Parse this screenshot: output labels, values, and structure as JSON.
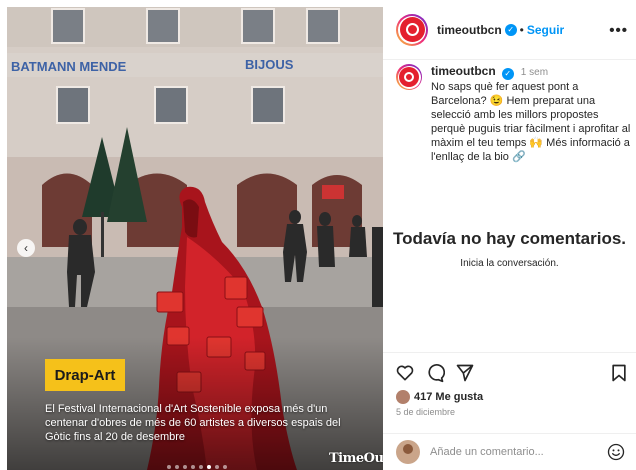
{
  "post_media": {
    "tag": "Drap-Art",
    "caption": "El Festival Internacional d'Art Sostenible exposa més d'un centenar d'obres de més de 60 artistes a diversos espais del Gòtic fins al 20 de desembre",
    "watermark": "TimeOut",
    "carousel_dots": 8,
    "active_dot": 6,
    "storefront_signs": [
      "BATMANN MENDE",
      "BIJOUS"
    ],
    "colors": {
      "tag_bg": "#f5c11a",
      "sculpture": "#c81e1e"
    }
  },
  "header": {
    "username": "timeoutbcn",
    "separator": "•",
    "follow_label": "Seguir",
    "more_label": "•••"
  },
  "post": {
    "username": "timeoutbcn",
    "time": "1 sem",
    "text": "No saps què fer aquest pont a Barcelona? 😉 Hem preparat una selecció amb les millors propostes perquè puguis triar fàcilment i aprofitar al màxim el teu temps 🙌 Més informació a l'enllaç de la bio 🔗"
  },
  "comments": {
    "empty_title": "Todavía no hay comentarios.",
    "empty_subtitle": "Inicia la conversación."
  },
  "actions": {
    "icons": [
      "heart-icon",
      "comment-icon",
      "share-icon",
      "save-icon"
    ],
    "likes": "417 Me gusta",
    "date": "5 de diciembre"
  },
  "comment_box": {
    "placeholder": "Añade un comentario...",
    "emoji_icon": "smiley-icon"
  },
  "colors": {
    "accent": "#0095f6",
    "text": "#262626",
    "muted": "#8e8e8e"
  }
}
